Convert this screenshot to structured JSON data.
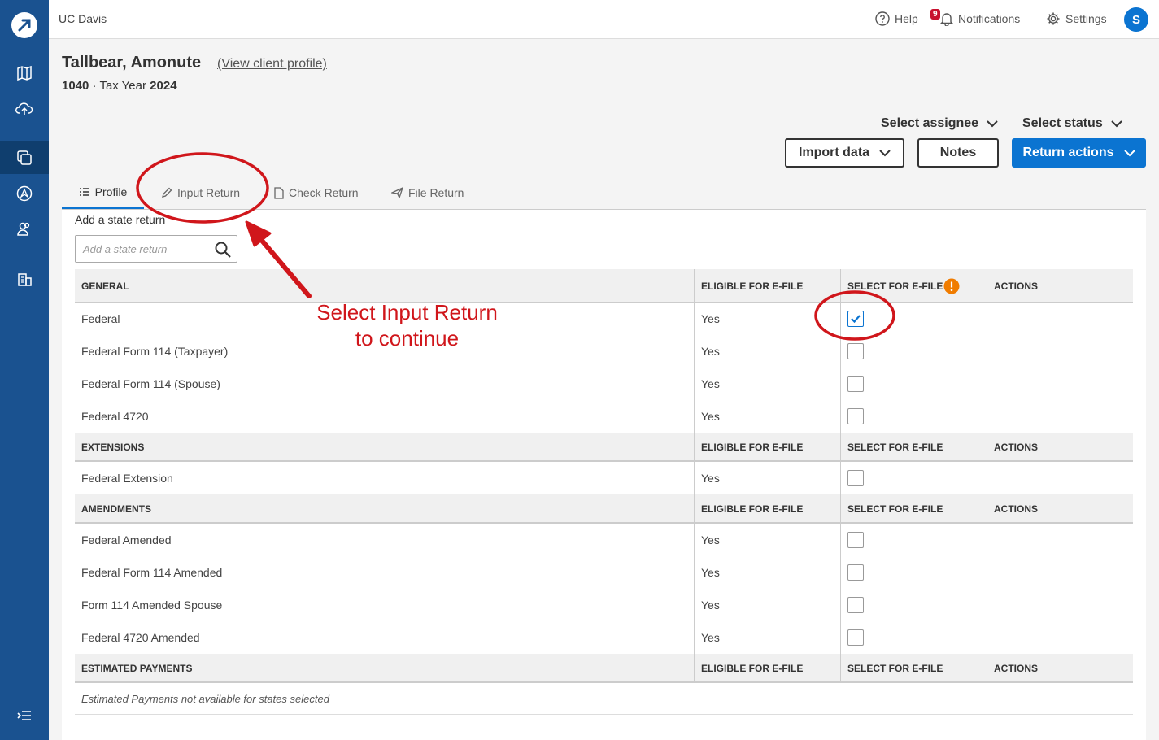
{
  "org_name": "UC Davis",
  "topbar": {
    "help": "Help",
    "notifications": "Notifications",
    "notification_count": "9",
    "settings": "Settings",
    "avatar_initial": "S"
  },
  "client": {
    "name": "Tallbear, Amonute",
    "view_profile": "(View client profile)",
    "form": "1040",
    "tax_year_label": "· Tax Year",
    "tax_year": "2024"
  },
  "controls": {
    "select_assignee": "Select assignee",
    "select_status": "Select status",
    "import_data": "Import data",
    "notes": "Notes",
    "return_actions": "Return actions"
  },
  "tabs": [
    "Profile",
    "Input Return",
    "Check Return",
    "File Return"
  ],
  "state_return": {
    "label": "Add a state return",
    "placeholder": "Add a state return"
  },
  "columns": {
    "eligible": "ELIGIBLE FOR E-FILE",
    "select": "SELECT FOR E-FILE",
    "actions": "ACTIONS"
  },
  "sections": {
    "general": {
      "title": "GENERAL",
      "rows": [
        {
          "name": "Federal",
          "eligible": "Yes",
          "checked": true
        },
        {
          "name": "Federal Form 114 (Taxpayer)",
          "eligible": "Yes",
          "checked": false
        },
        {
          "name": "Federal Form 114 (Spouse)",
          "eligible": "Yes",
          "checked": false
        },
        {
          "name": "Federal 4720",
          "eligible": "Yes",
          "checked": false
        }
      ]
    },
    "extensions": {
      "title": "EXTENSIONS",
      "rows": [
        {
          "name": "Federal Extension",
          "eligible": "Yes",
          "checked": false
        }
      ]
    },
    "amendments": {
      "title": "AMENDMENTS",
      "rows": [
        {
          "name": "Federal Amended",
          "eligible": "Yes",
          "checked": false
        },
        {
          "name": "Federal Form 114 Amended",
          "eligible": "Yes",
          "checked": false
        },
        {
          "name": "Form 114 Amended Spouse",
          "eligible": "Yes",
          "checked": false
        },
        {
          "name": "Federal 4720 Amended",
          "eligible": "Yes",
          "checked": false
        }
      ]
    },
    "estimated": {
      "title": "ESTIMATED PAYMENTS",
      "note": "Estimated Payments not available for states selected"
    }
  },
  "annotation": {
    "line1": "Select Input Return",
    "line2": "to continue"
  },
  "colors": {
    "rail": "#1a5290",
    "primary": "#0b74d1",
    "annotation": "#d0161b",
    "warning": "#f07c00"
  }
}
